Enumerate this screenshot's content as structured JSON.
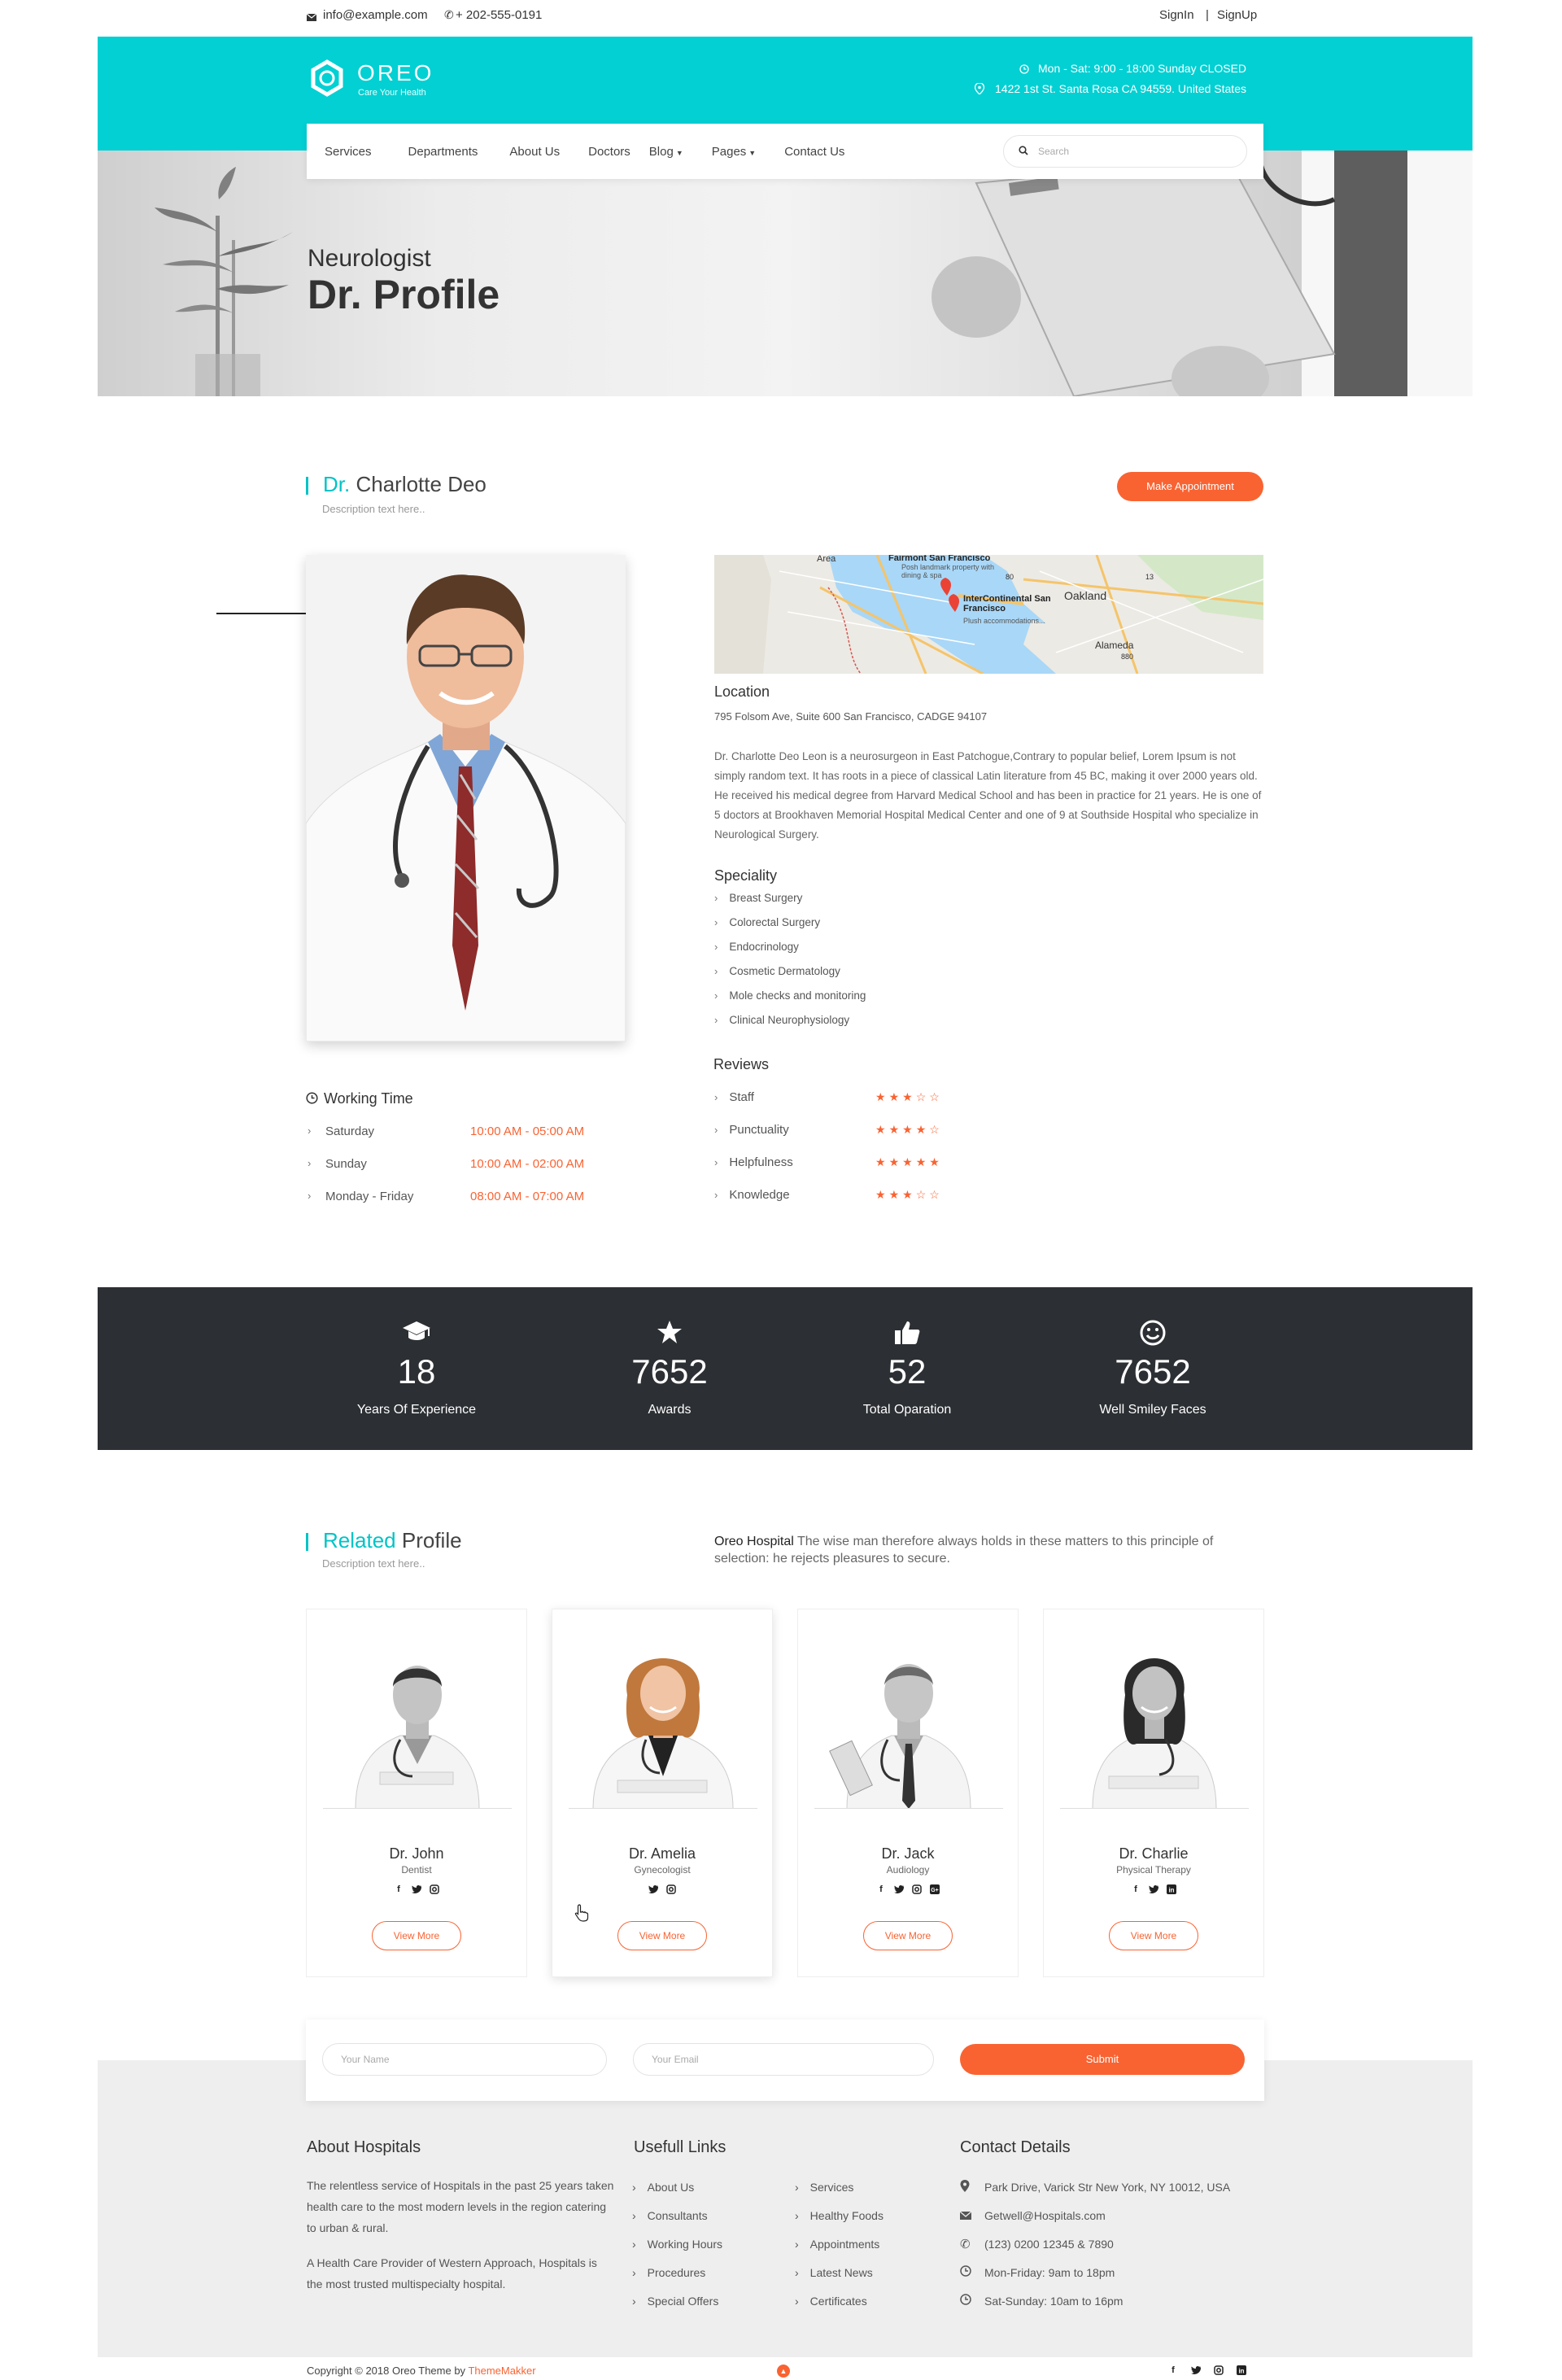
{
  "topbar": {
    "email": "info@example.com",
    "phone": "+ 202-555-0191",
    "signin": "SignIn",
    "separator": "|",
    "signup": "SignUp"
  },
  "brand": {
    "name": "OREO",
    "tagline": "Care Your Health",
    "hours": "Mon - Sat: 9:00 - 18:00 Sunday CLOSED",
    "address": "1422 1st St. Santa Rosa CA 94559. United States"
  },
  "nav": {
    "items": [
      "Services",
      "Departments",
      "About Us",
      "Doctors",
      "Blog",
      "Pages",
      "Contact Us"
    ],
    "search_placeholder": "Search"
  },
  "hero": {
    "subtitle": "Neurologist",
    "title": "Dr. Profile"
  },
  "profile": {
    "prefix": "Dr.",
    "name": "Charlotte Deo",
    "description": "Description text here..",
    "appointment_button": "Make Appointment",
    "location_heading": "Location",
    "address": "795 Folsom Ave, Suite 600 San Francisco, CADGE 94107",
    "bio": "Dr. Charlotte Deo Leon is a neurosurgeon in East Patchogue,Contrary to popular belief, Lorem Ipsum is not simply random text. It has roots in a piece of classical Latin literature from 45 BC, making it over 2000 years old. He received his medical degree from Harvard Medical School and has been in practice for 21 years. He is one of 5 doctors at Brookhaven Memorial Hospital Medical Center and one of 9 at Southside Hospital who specialize in Neurological Surgery.",
    "speciality_heading": "Speciality",
    "specialities": [
      "Breast Surgery",
      "Colorectal Surgery",
      "Endocrinology",
      "Cosmetic Dermatology",
      "Mole checks and monitoring",
      "Clinical Neurophysiology"
    ],
    "reviews_heading": "Reviews",
    "reviews": [
      {
        "label": "Staff",
        "stars": 3
      },
      {
        "label": "Punctuality",
        "stars": 4
      },
      {
        "label": "Helpfulness",
        "stars": 5
      },
      {
        "label": "Knowledge",
        "stars": 3
      }
    ],
    "working_heading": "Working Time",
    "working": [
      {
        "day": "Saturday",
        "time": "10:00 AM - 05:00 AM"
      },
      {
        "day": "Sunday",
        "time": "10:00 AM - 02:00 AM"
      },
      {
        "day": "Monday - Friday",
        "time": "08:00 AM - 07:00 AM"
      }
    ]
  },
  "map": {
    "labels": [
      "Area",
      "Fairmont San Francisco",
      "Posh landmark property with dining & spa",
      "InterContinental San Francisco",
      "Plush accommodations...",
      "Oakland",
      "Alameda",
      "80",
      "880",
      "13"
    ]
  },
  "stats": [
    {
      "icon": "graduation-cap-icon",
      "value": "18",
      "label": "Years Of Experience"
    },
    {
      "icon": "star-icon",
      "value": "7652",
      "label": "Awards"
    },
    {
      "icon": "thumbs-up-icon",
      "value": "52",
      "label": "Total Oparation"
    },
    {
      "icon": "smiley-icon",
      "value": "7652",
      "label": "Well Smiley Faces"
    }
  ],
  "related": {
    "accent": "Related",
    "title": "Profile",
    "description": "Description text here..",
    "intro_brand": "Oreo Hospital",
    "intro_text": "The wise man therefore always holds in these matters to this principle of selection: he rejects pleasures to secure.",
    "view_more": "View More",
    "doctors": [
      {
        "name": "Dr. John",
        "role": "Dentist"
      },
      {
        "name": "Dr. Amelia",
        "role": "Gynecologist"
      },
      {
        "name": "Dr. Jack",
        "role": "Audiology"
      },
      {
        "name": "Dr. Charlie",
        "role": "Physical Therapy"
      }
    ]
  },
  "subscribe": {
    "name_placeholder": "Your Name",
    "email_placeholder": "Your Email",
    "submit": "Submit"
  },
  "footer": {
    "about_heading": "About Hospitals",
    "about_p1": "The relentless service of Hospitals in the past 25 years taken health care to the most modern levels in the region catering to urban & rural.",
    "about_p2": "A Health Care Provider of Western Approach, Hospitals is the most trusted multispecialty hospital.",
    "links_heading": "Usefull Links",
    "links_col1": [
      "About Us",
      "Consultants",
      "Working Hours",
      "Procedures",
      "Special Offers"
    ],
    "links_col2": [
      "Services",
      "Healthy Foods",
      "Appointments",
      "Latest News",
      "Certificates"
    ],
    "contact_heading": "Contact Details",
    "contacts": [
      {
        "icon": "map-marker-icon",
        "text": "Park Drive, Varick Str New York, NY 10012, USA"
      },
      {
        "icon": "envelope-icon",
        "text": "Getwell@Hospitals.com"
      },
      {
        "icon": "phone-icon",
        "text": "(123) 0200 12345 & 7890"
      },
      {
        "icon": "clock-icon",
        "text": "Mon-Friday: 9am to 18pm"
      },
      {
        "icon": "clock-icon",
        "text": "Sat-Sunday: 10am to 16pm"
      }
    ],
    "copyright": "Copyright © 2018 Oreo Theme by",
    "credit": "ThemeMakker"
  },
  "colors": {
    "accent": "#03d0d3",
    "orange": "#f96332",
    "dark": "#2c2f33"
  }
}
